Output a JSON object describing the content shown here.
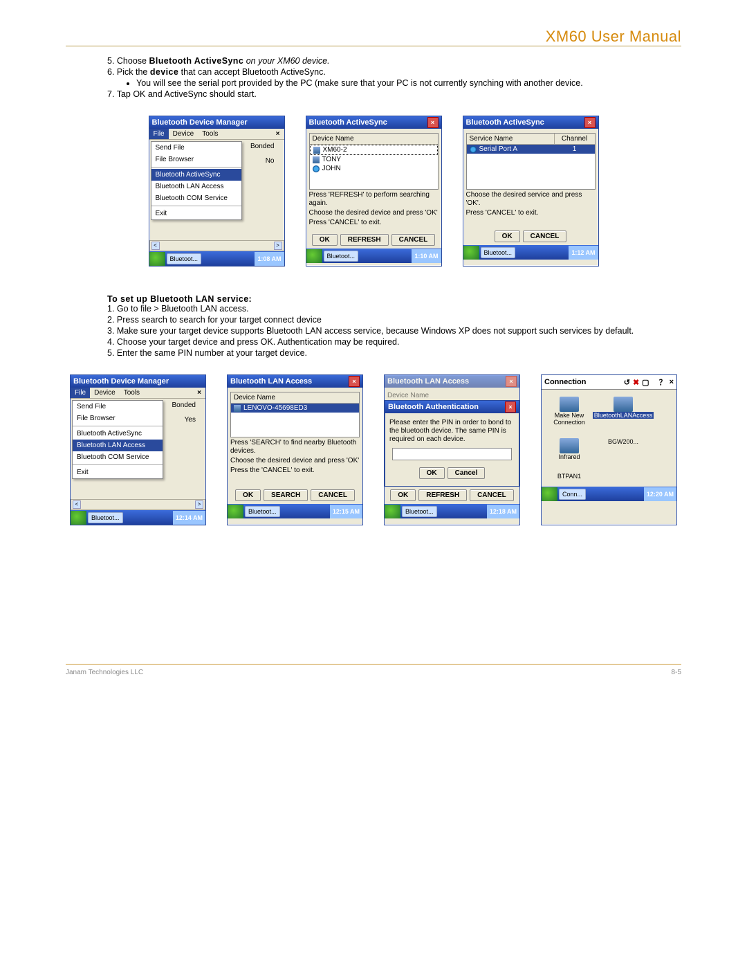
{
  "header": {
    "title": "XM60 User Manual"
  },
  "instr1": {
    "n5": "5.  Choose",
    "s5a": "Bluetooth ActiveSync",
    "s5b": "on your XM60 device.",
    "n6": "6.  Pick the",
    "s6a": "device",
    "s6b": "that can accept Bluetooth ActiveSync.",
    "sub": "You will see the serial port provided by the PC (make sure that your PC is not currently synching with another device.",
    "n7": "7.",
    "s7": "Tap OK and ActiveSync should start."
  },
  "btn": {
    "ok": "OK",
    "refresh": "REFRESH",
    "cancel": "CANCEL",
    "search": "SEARCH",
    "cancel2": "Cancel"
  },
  "r1a": {
    "title": "Bluetooth Device Manager",
    "mFile": "File",
    "mDev": "Device",
    "mTools": "Tools",
    "dd": [
      "Send File",
      "File Browser",
      "Bluetooth ActiveSync",
      "Bluetooth LAN Access",
      "Bluetooth COM Service",
      "Exit"
    ],
    "c1": "Bonded",
    "c2": "No",
    "task": "Bluetoot...",
    "time": "1:08 AM"
  },
  "r1b": {
    "title": "Bluetooth ActiveSync",
    "hdr": "Device Name",
    "d": [
      "XM60-2",
      "TONY",
      "JOHN"
    ],
    "h1": "Press 'REFRESH' to perform searching again.",
    "h2": "Choose the desired device and press 'OK'",
    "h3": "Press 'CANCEL' to exit.",
    "time": "1:10 AM"
  },
  "r1c": {
    "title": "Bluetooth ActiveSync",
    "h1": "Service Name",
    "h2": "Channel",
    "svc": "Serial Port A",
    "ch": "1",
    "t1": "Choose the desired service and press 'OK'.",
    "t2": "Press 'CANCEL' to exit.",
    "time": "1:12 AM"
  },
  "instr2": {
    "title": "To set up Bluetooth LAN service:",
    "steps": [
      "1.  Go to file > Bluetooth LAN access.",
      "2.  Press search to search for your target connect device",
      "3.  Make sure your target device supports Bluetooth LAN access service, because Windows XP does not support such services by default.",
      "4.  Choose your target device and press OK. Authentication may be required.",
      "5.  Enter the same PIN number at your target device."
    ]
  },
  "r2a": {
    "c2": "Yes",
    "time": "12:14 AM"
  },
  "r2b": {
    "title": "Bluetooth LAN Access",
    "dev": "LENOVO-45698ED3",
    "h1": "Press 'SEARCH' to find nearby Bluetooth devices.",
    "h2": "Choose the desired device and press 'OK'",
    "h3": "Press the 'CANCEL' to exit.",
    "time": "12:15 AM"
  },
  "r2c": {
    "title": "Bluetooth Authentication",
    "msg": "Please enter the PIN in order to bond to the bluetooth device. The same PIN is required on each device.",
    "time": "12:18 AM"
  },
  "r2d": {
    "title": "Connection",
    "i": [
      "Make New Connection",
      "BluetoothLANAccess",
      "Infrared",
      "BGW200...",
      "BTPAN1"
    ],
    "task": "Conn...",
    "time": "12:20 AM"
  },
  "footer": {
    "left": "Janam Technologies LLC",
    "right": "8-5"
  }
}
